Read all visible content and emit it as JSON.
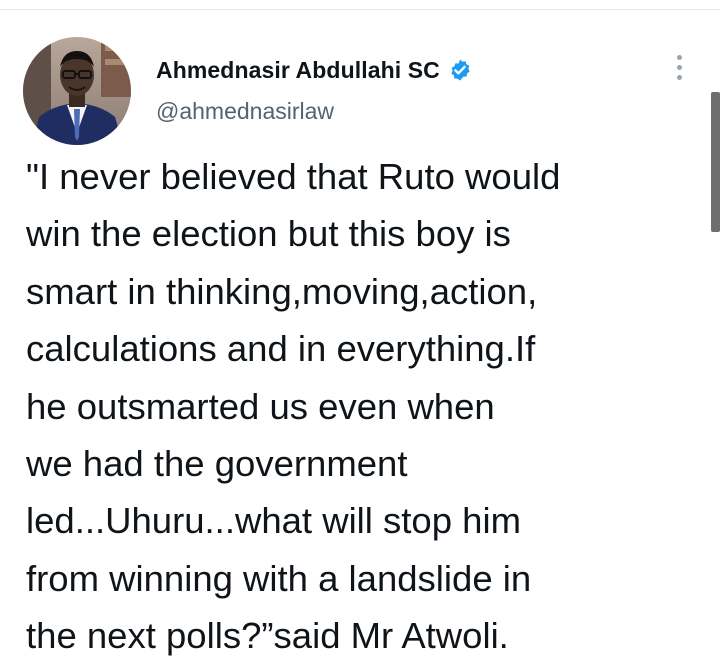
{
  "tweet": {
    "author": {
      "name": "Ahmednasir Abdullahi SC",
      "handle": "@ahmednasirlaw",
      "verified": true,
      "avatar_icon": "profile-photo-man-in-suit"
    },
    "menu_icon": "more-vertical-icon",
    "text_lines": [
      "\"I never believed that Ruto would",
      "win the election but this boy is",
      "smart in thinking,moving,action,",
      "calculations and in everything.If",
      "he outsmarted us even when",
      "we had the government",
      "led...Uhuru...what will stop him",
      "from winning with a landslide in",
      "the next polls?”said Mr Atwoli."
    ]
  },
  "colors": {
    "text": "#0f1419",
    "secondary_text": "#536471",
    "verified_badge": "#1d9bf0",
    "background": "#ffffff"
  }
}
